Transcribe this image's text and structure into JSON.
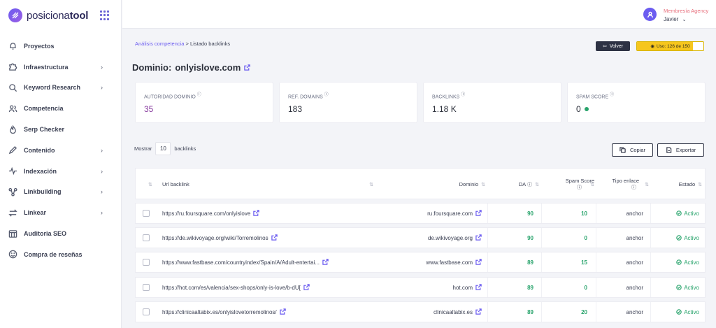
{
  "app": {
    "logo_text_light": "posiciona",
    "logo_text_bold": "tool"
  },
  "sidebar": {
    "items": [
      {
        "label": "Proyectos",
        "icon": "bell-icon",
        "has_chevron": false
      },
      {
        "label": "Infraestructura",
        "icon": "puzzle-icon",
        "has_chevron": true
      },
      {
        "label": "Keyword Research",
        "icon": "search-icon",
        "has_chevron": true
      },
      {
        "label": "Competencia",
        "icon": "users-icon",
        "has_chevron": false
      },
      {
        "label": "Serp Checker",
        "icon": "flame-icon",
        "has_chevron": false
      },
      {
        "label": "Contenido",
        "icon": "pencil-icon",
        "has_chevron": true
      },
      {
        "label": "Indexación",
        "icon": "pulse-icon",
        "has_chevron": true
      },
      {
        "label": "Linkbuilding",
        "icon": "nodes-icon",
        "has_chevron": true
      },
      {
        "label": "Linkear",
        "icon": "arrows-icon",
        "has_chevron": true
      },
      {
        "label": "Auditoria SEO",
        "icon": "grid-calendar-icon",
        "has_chevron": false
      },
      {
        "label": "Compra de reseñas",
        "icon": "smile-icon",
        "has_chevron": false
      }
    ]
  },
  "header": {
    "membership": "Membresía Agency",
    "user": "Javier"
  },
  "breadcrumb": {
    "link": "Análisis competencia",
    "separator": ">",
    "current": "Listado backlinks"
  },
  "actions": {
    "back_label": "Volver",
    "usage_label": "Uso: 126 de 150",
    "usage_fraction": 0.84
  },
  "domain": {
    "prefix": "Dominio:",
    "name": "onlyislove.com"
  },
  "stats": [
    {
      "label": "Autoridad dominio",
      "value": "35",
      "accent": "#8a3fa0"
    },
    {
      "label": "Ref. Domains",
      "value": "183"
    },
    {
      "label": "Backlinks",
      "value": "1.18 K"
    },
    {
      "label": "Spam Score",
      "value": "0",
      "status_color": "#27a36b"
    }
  ],
  "controls": {
    "show_label": "Mostrar",
    "show_value": "10",
    "show_suffix": "backlinks",
    "copy_label": "Copiar",
    "export_label": "Exportar"
  },
  "table": {
    "columns": [
      "Url backlink",
      "Dominio",
      "DA",
      "Spam Score",
      "Tipo enlace",
      "Estado"
    ],
    "rows": [
      {
        "url": "https://ru.foursquare.com/onlyislove",
        "domain": "ru.foursquare.com",
        "da": "90",
        "spam": "10",
        "type": "anchor",
        "status": "Activo"
      },
      {
        "url": "https://de.wikivoyage.org/wiki/Torremolinos",
        "domain": "de.wikivoyage.org",
        "da": "90",
        "spam": "0",
        "type": "anchor",
        "status": "Activo"
      },
      {
        "url": "https://www.fastbase.com/countryindex/Spain/A/Adult-entertai...",
        "domain": "www.fastbase.com",
        "da": "89",
        "spam": "15",
        "type": "anchor",
        "status": "Activo"
      },
      {
        "url": "https://hot.com/es/valencia/sex-shops/only-is-love/b-dU[",
        "domain": "hot.com",
        "da": "89",
        "spam": "0",
        "type": "anchor",
        "status": "Activo"
      },
      {
        "url": "https://clinicaaltabix.es/onlyislovetorremolinos/",
        "domain": "clinicaaltabix.es",
        "da": "89",
        "spam": "20",
        "type": "anchor",
        "status": "Activo"
      }
    ]
  }
}
